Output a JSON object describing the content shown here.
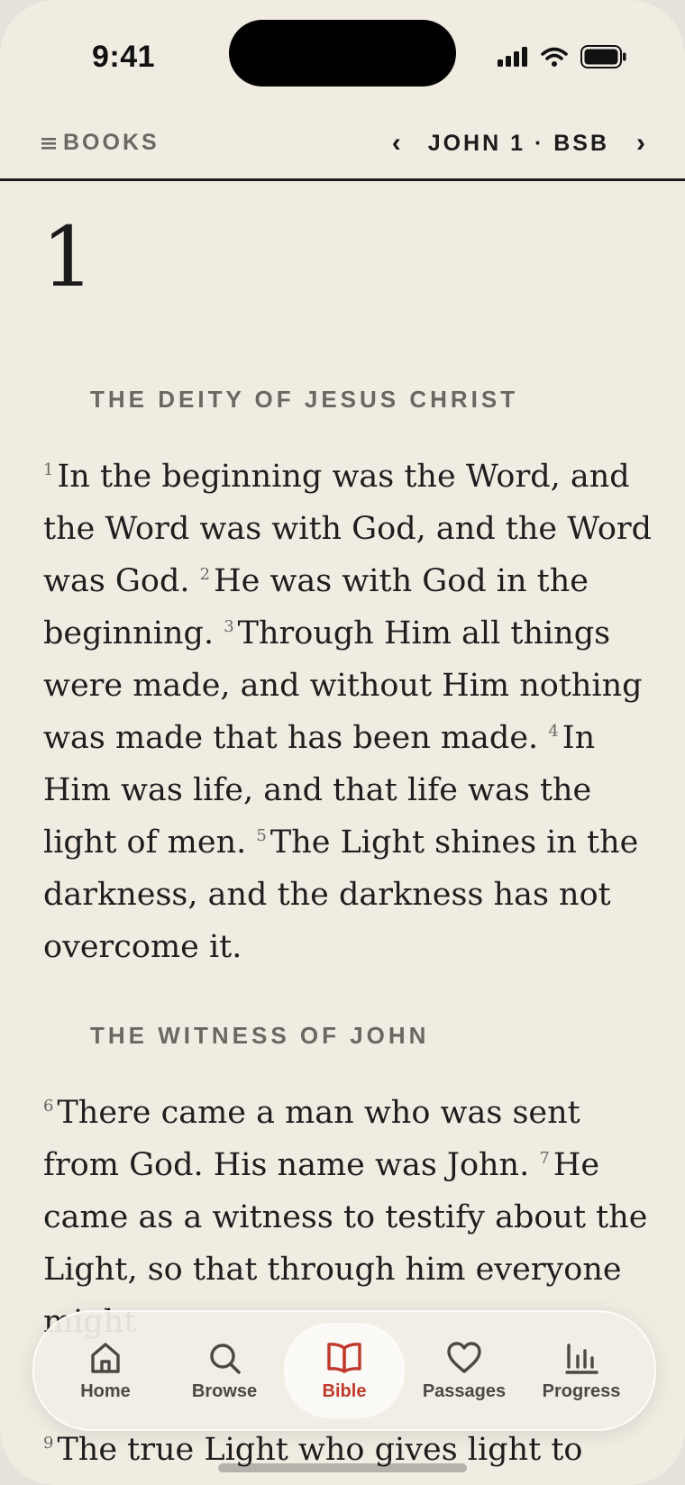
{
  "status": {
    "time": "9:41"
  },
  "header": {
    "books_label": "BOOKS",
    "reference": "JOHN 1 · BSB",
    "prev_icon": "chevron-left",
    "next_icon": "chevron-right",
    "menu_icon": "hamburger"
  },
  "reader": {
    "chapter_number": "1",
    "sections": [
      {
        "heading": "THE DEITY OF JESUS CHRIST",
        "verses": [
          {
            "num": "1",
            "text": "In the beginning was the Word, and the Word was with God, and the Word was God."
          },
          {
            "num": "2",
            "text": "He was with God in the beginning."
          },
          {
            "num": "3",
            "text": "Through Him all things were made, and without Him nothing was made that has been made."
          },
          {
            "num": "4",
            "text": "In Him was life, and that life was the light of men."
          },
          {
            "num": "5",
            "text": "The Light shines in the darkness, and the darkness has not overcome it."
          }
        ]
      },
      {
        "heading": "THE WITNESS OF JOHN",
        "verses": [
          {
            "num": "6",
            "text": "There came a man who was sent from God. His name was John."
          },
          {
            "num": "7",
            "text": "He came as a witness to testify about the Light, so that through him everyone might"
          }
        ]
      }
    ],
    "trailing_verse": {
      "num": "9",
      "text": "The true Light who gives light to"
    }
  },
  "tabbar": {
    "active": "Bible",
    "accent_color": "#c0392b",
    "tabs": [
      {
        "label": "Home",
        "icon": "house-icon"
      },
      {
        "label": "Browse",
        "icon": "search-icon"
      },
      {
        "label": "Bible",
        "icon": "open-book-icon"
      },
      {
        "label": "Passages",
        "icon": "heart-icon"
      },
      {
        "label": "Progress",
        "icon": "bar-chart-icon"
      }
    ]
  }
}
